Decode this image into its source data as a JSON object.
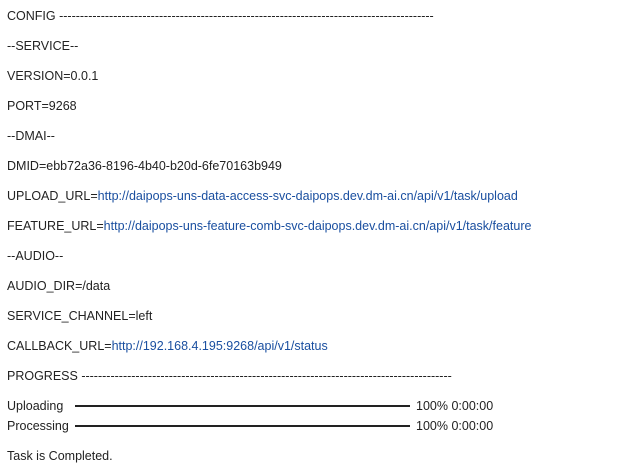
{
  "lines": {
    "config_header": " CONFIG ------------------------------------------------------------------------------------------",
    "service_header": "--SERVICE--",
    "version": "VERSION=0.0.1",
    "port": "PORT=9268",
    "dmai_header": "--DMAI--",
    "dmid": "DMID=ebb72a36-8196-4b40-b20d-6fe70163b949",
    "upload_key": "UPLOAD_URL=",
    "upload_url": "http://daipops-uns-data-access-svc-daipops.dev.dm-ai.cn/api/v1/task/upload",
    "feature_key": "FEATURE_URL=",
    "feature_url": "http://daipops-uns-feature-comb-svc-daipops.dev.dm-ai.cn/api/v1/task/feature",
    "audio_header": "--AUDIO--",
    "audio_dir": "AUDIO_DIR=/data",
    "service_channel": "SERVICE_CHANNEL=left",
    "callback_key": "CALLBACK_URL=",
    "callback_url": "http://192.168.4.195:9268/api/v1/status",
    "progress_header": "PROGRESS -----------------------------------------------------------------------------------------",
    "completed": "Task is Completed."
  },
  "progress": [
    {
      "label": "Uploading",
      "fraction": 1.0,
      "percent": "100%",
      "time": "0:00:00"
    },
    {
      "label": "Processing",
      "fraction": 1.0,
      "percent": "100%",
      "time": "0:00:00"
    }
  ],
  "colors": {
    "text": "#222222",
    "link": "#1a4fa0",
    "bar_fill": "#222222"
  }
}
